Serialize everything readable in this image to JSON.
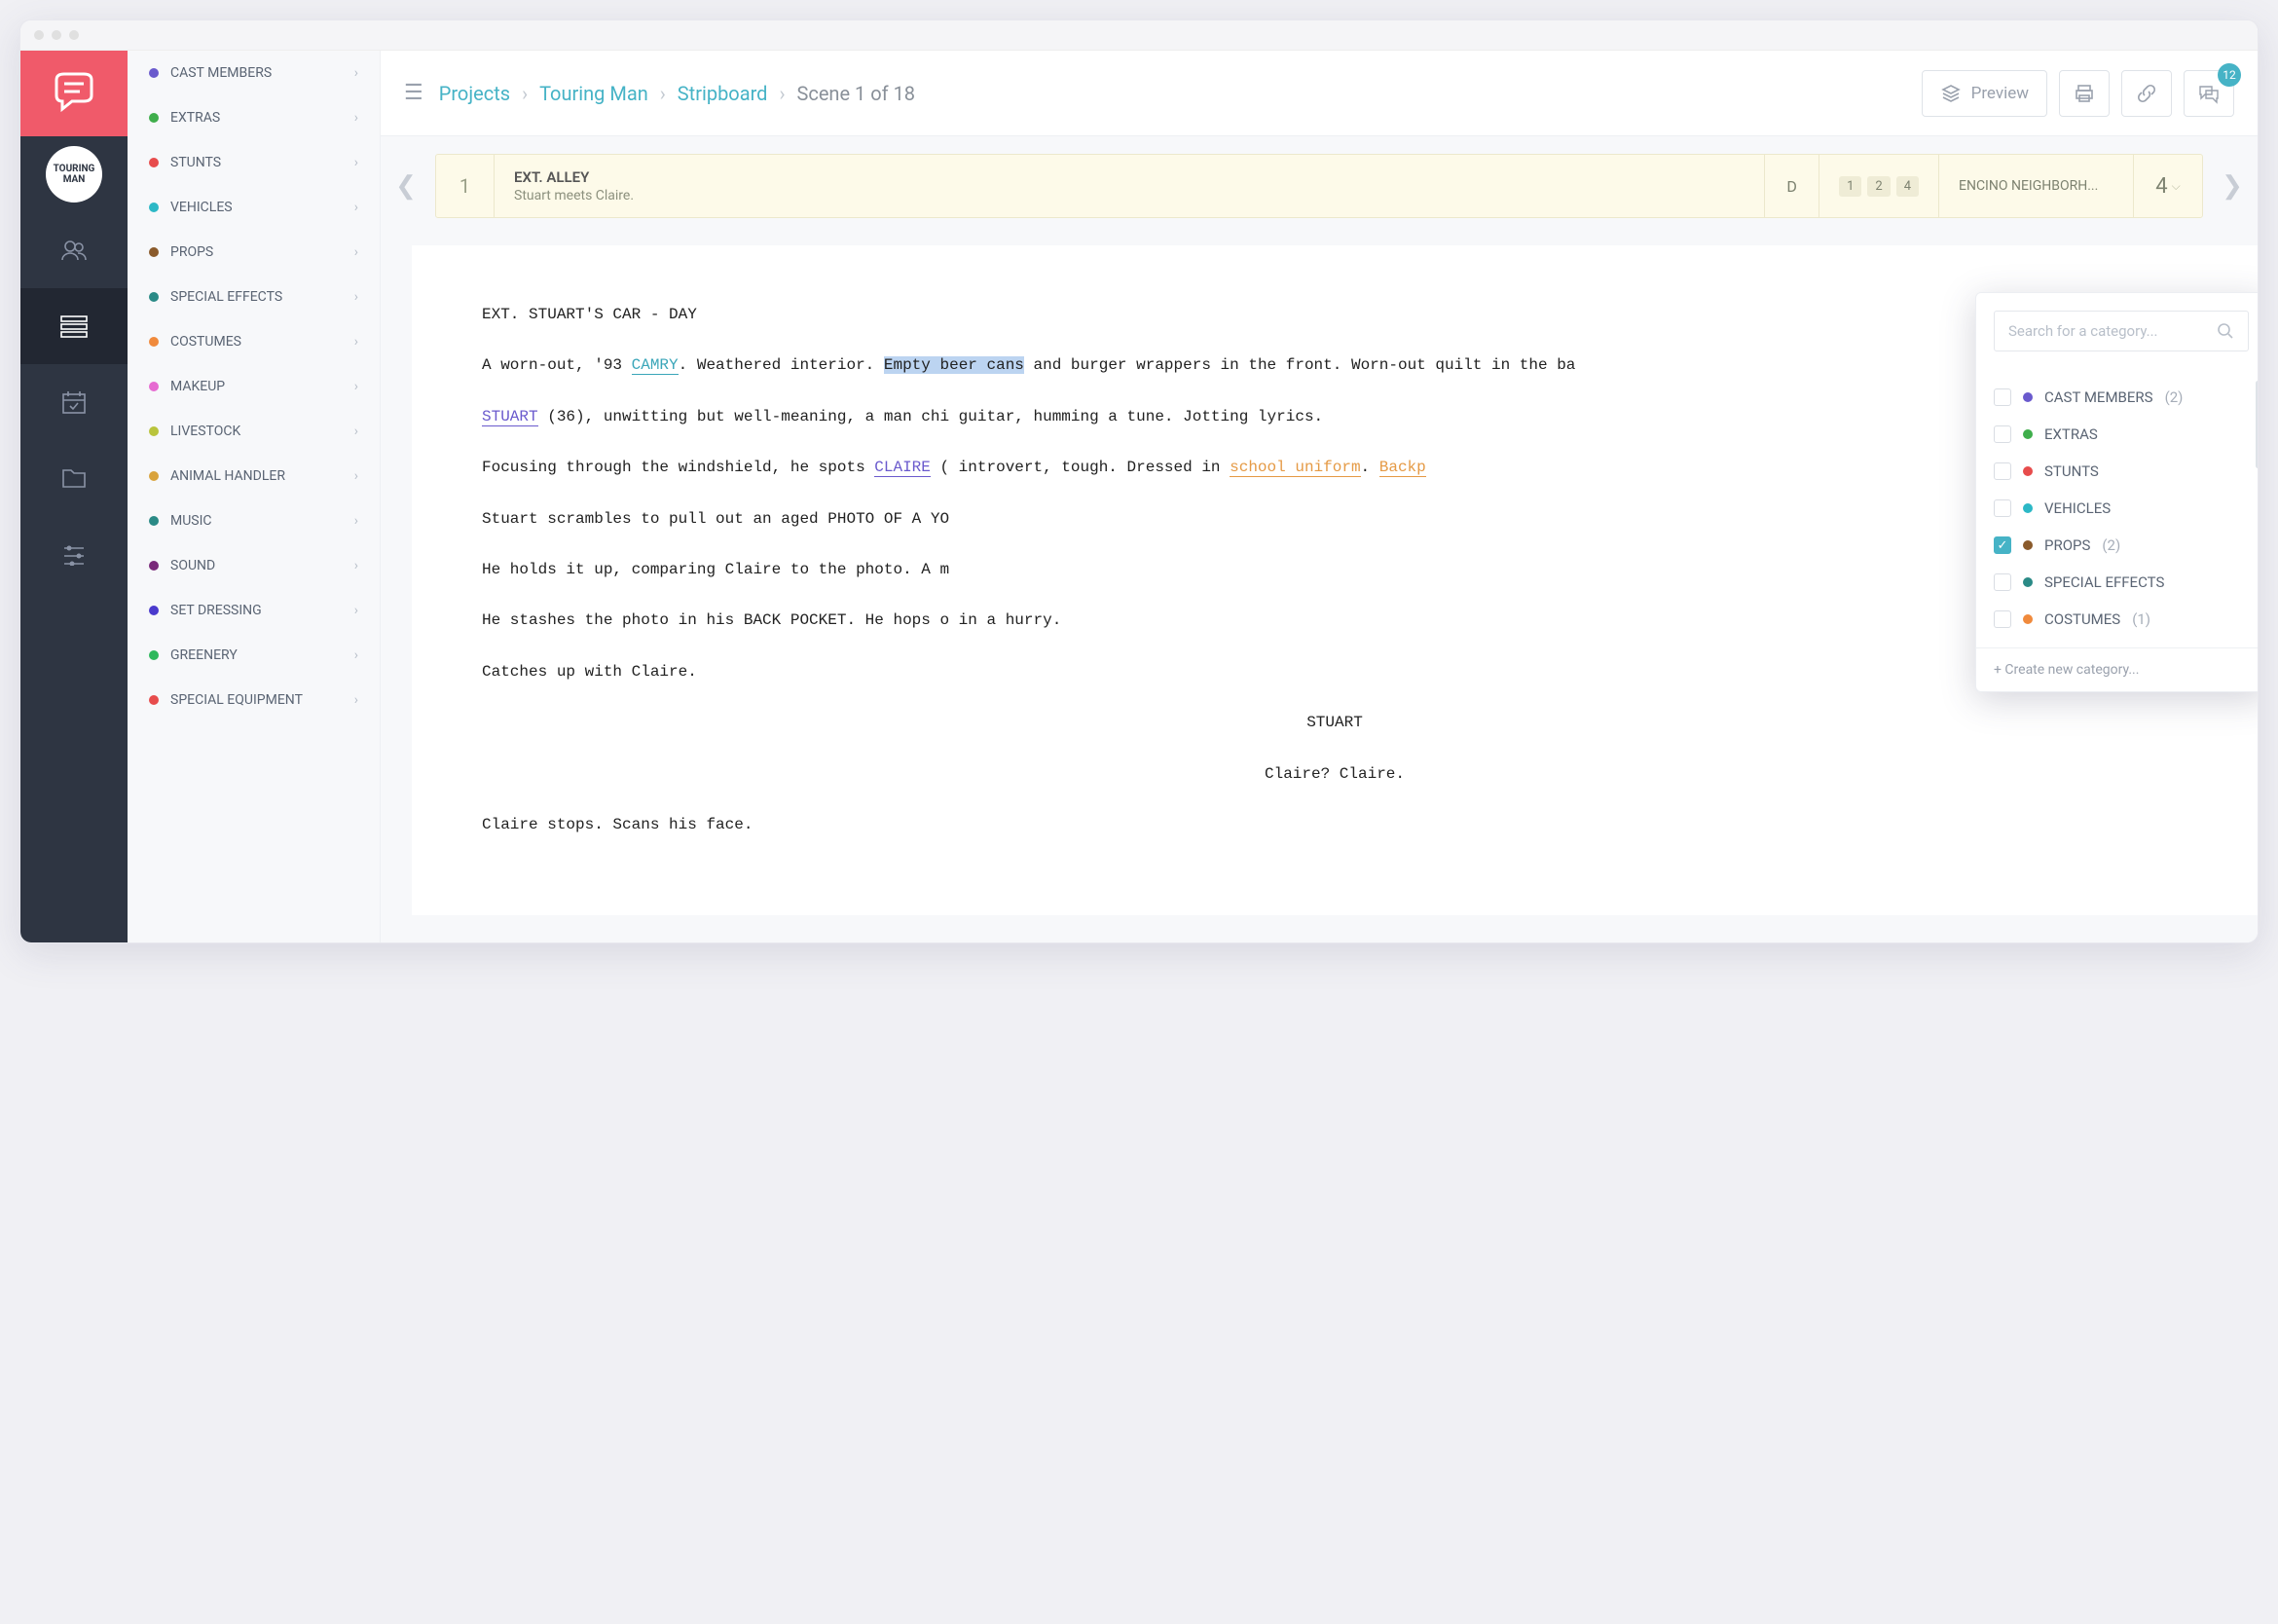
{
  "project_badge": "TOURING MAN",
  "breadcrumbs": {
    "root": "Projects",
    "project": "Touring Man",
    "view": "Stripboard",
    "current": "Scene 1 of 18"
  },
  "toolbar": {
    "preview": "Preview",
    "chat_badge": "12"
  },
  "sidebar": {
    "items": [
      {
        "label": "CAST MEMBERS",
        "color": "#6a5acd"
      },
      {
        "label": "EXTRAS",
        "color": "#3fae4b"
      },
      {
        "label": "STUNTS",
        "color": "#e74c4c"
      },
      {
        "label": "VEHICLES",
        "color": "#2cb8c6"
      },
      {
        "label": "PROPS",
        "color": "#8a5a2b"
      },
      {
        "label": "SPECIAL EFFECTS",
        "color": "#2a8a86"
      },
      {
        "label": "COSTUMES",
        "color": "#f08a3c"
      },
      {
        "label": "MAKEUP",
        "color": "#e66bd1"
      },
      {
        "label": "LIVESTOCK",
        "color": "#b9c43c"
      },
      {
        "label": "ANIMAL HANDLER",
        "color": "#d9a33c"
      },
      {
        "label": "MUSIC",
        "color": "#2a8a86"
      },
      {
        "label": "SOUND",
        "color": "#7a2a7a"
      },
      {
        "label": "SET DRESSING",
        "color": "#4a3acd"
      },
      {
        "label": "GREENERY",
        "color": "#2eb85c"
      },
      {
        "label": "SPECIAL EQUIPMENT",
        "color": "#e74c4c"
      }
    ]
  },
  "strip": {
    "number": "1",
    "slugline": "EXT. ALLEY",
    "synopsis": "Stuart meets Claire.",
    "daynight": "D",
    "tags": [
      "1",
      "2",
      "4"
    ],
    "location": "ENCINO NEIGHBORH...",
    "duration": "4"
  },
  "script": {
    "heading": "EXT. STUART'S CAR - DAY",
    "p1_a": "A worn-out, '93 ",
    "p1_car": "CAMRY",
    "p1_b": ". Weathered interior. ",
    "p1_beer": "Empty beer cans",
    "p1_c": " and burger wrappers in the front. Worn-out quilt in the ba",
    "p2_a": "",
    "p2_stuart": "STUART",
    "p2_b": " (36), unwitting but well-meaning, a man chi guitar, humming a tune. Jotting lyrics.",
    "p3_a": "Focusing through the windshield, he spots ",
    "p3_claire": "CLAIRE",
    "p3_b": " ( introvert, tough. Dressed in ",
    "p3_uniform": "school uniform",
    "p3_c": ". ",
    "p3_backp": "Backp",
    "p4": "Stuart scrambles to pull out an aged PHOTO OF A YO",
    "p5": "He holds it up, comparing Claire to the photo. A m",
    "p6": "He stashes the photo in his BACK POCKET. He hops o   in a hurry.",
    "p7": "Catches up with Claire.",
    "cue": "STUART",
    "line": "Claire? Claire.",
    "p8": "Claire stops. Scans his face."
  },
  "picker": {
    "placeholder": "Search for a category...",
    "items": [
      {
        "label": "CAST MEMBERS",
        "color": "#6a5acd",
        "count": "(2)",
        "checked": false
      },
      {
        "label": "EXTRAS",
        "color": "#3fae4b",
        "count": "",
        "checked": false
      },
      {
        "label": "STUNTS",
        "color": "#e74c4c",
        "count": "",
        "checked": false
      },
      {
        "label": "VEHICLES",
        "color": "#2cb8c6",
        "count": "",
        "checked": false
      },
      {
        "label": "PROPS",
        "color": "#8a5a2b",
        "count": "(2)",
        "checked": true
      },
      {
        "label": "SPECIAL EFFECTS",
        "color": "#2a8a86",
        "count": "",
        "checked": false
      },
      {
        "label": "COSTUMES",
        "color": "#f08a3c",
        "count": "(1)",
        "checked": false
      }
    ],
    "footer": "+ Create new category..."
  }
}
